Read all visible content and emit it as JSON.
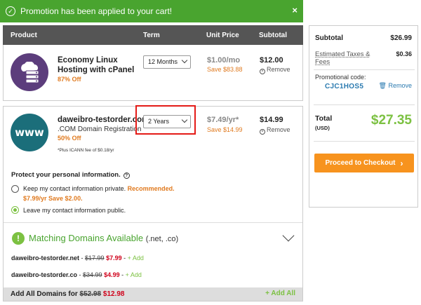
{
  "banner": {
    "message": "Promotion has been applied to your cart!",
    "close": "×"
  },
  "table_header": {
    "product": "Product",
    "term": "Term",
    "unit_price": "Unit Price",
    "subtotal": "Subtotal"
  },
  "items": [
    {
      "name_line1": "Economy Linux",
      "name_line2": "Hosting with cPanel",
      "discount": "87% Off",
      "term": "12 Months",
      "price": "$1.00/mo",
      "save": "Save $83.88",
      "subtotal": "$12.00",
      "remove": "Remove",
      "icon_color": "#5c3d7c"
    },
    {
      "name": "daweibro-testorder.com",
      "desc": ".COM Domain Registration",
      "discount": "50% Off",
      "term": "2 Years",
      "price": "$7.49/yr*",
      "save": "Save $14.99",
      "subtotal": "$14.99",
      "remove": "Remove",
      "icann": "*Plus ICANN fee of $0.18/yr",
      "icon_text": "www",
      "icon_color": "#1b6e7a"
    }
  ],
  "privacy": {
    "title": "Protect your personal information.",
    "option_private": "Keep my contact information private.",
    "recommended": "Recommended.",
    "private_price": "$7.99/yr Save $2.00.",
    "option_public": "Leave my contact information public."
  },
  "matching": {
    "title": "Matching Domains Available",
    "tlds": "(.net, .co)",
    "domains": [
      {
        "name": "daweibro-testorder.net",
        "sep": " - ",
        "old": "$17.99",
        "new": "$7.99",
        "add": "+ Add"
      },
      {
        "name": "daweibro-testorder.co",
        "sep": " - ",
        "old": "$34.99",
        "new": "$4.99",
        "add": "+ Add"
      }
    ],
    "add_all_label": "Add All Domains for",
    "add_all_old": "$52.98",
    "add_all_new": "$12.98",
    "add_all_button": "+ Add All"
  },
  "summary": {
    "subtotal_label": "Subtotal",
    "subtotal": "$26.99",
    "taxes_label": "Estimated Taxes & Fees",
    "taxes": "$0.36",
    "promo_label": "Promotional code:",
    "promo_code": "CJC1HOS5",
    "promo_remove": "Remove",
    "total_label": "Total",
    "currency": "(USD)",
    "total": "$27.35",
    "checkout_label": "Proceed to Checkout"
  },
  "colors": {
    "green": "#49a42f",
    "orange": "#f7931e",
    "red_highlight": "#e41b17",
    "header_gray": "#555555"
  }
}
